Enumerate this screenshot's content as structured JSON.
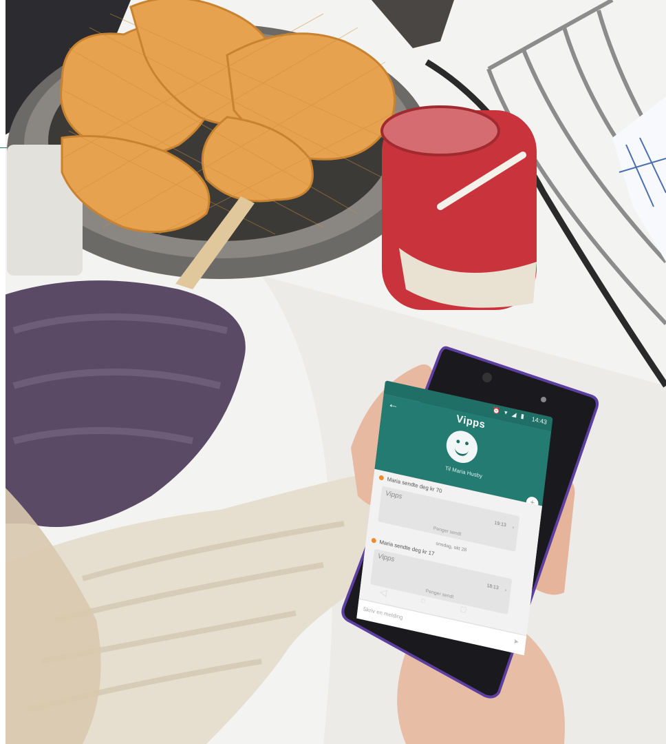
{
  "scene": {
    "description_colors": {
      "background": "#f4f4f2",
      "accent_teal": "#237b71",
      "jam_red": "#b32a2e",
      "phone_purple": "#4a2c7a"
    }
  },
  "phone": {
    "status_bar": {
      "icons": "⏰ ▾ ◢ ▮",
      "time": "14:43"
    },
    "app": {
      "back_icon": "arrow-left-icon",
      "brand": "Vipps",
      "avatar_icon": "smiley-face-icon",
      "to_label": "Til Maria Husby"
    },
    "feed": {
      "items": [
        {
          "note": "Maria sendte deg kr 70",
          "card_title": "Vipps",
          "time": "19:13",
          "status": "Penger sendt"
        },
        {
          "date": "onsdag, okt 28",
          "note": "Maria sendte deg kr 17",
          "card_title": "Vipps",
          "time": "18:13",
          "status": "Penger sendt"
        }
      ]
    },
    "compose": {
      "placeholder": "Skriv en melding",
      "send_icon": "send-icon"
    },
    "navbar": {
      "back": "◁",
      "home": "○",
      "recents": "□"
    }
  }
}
